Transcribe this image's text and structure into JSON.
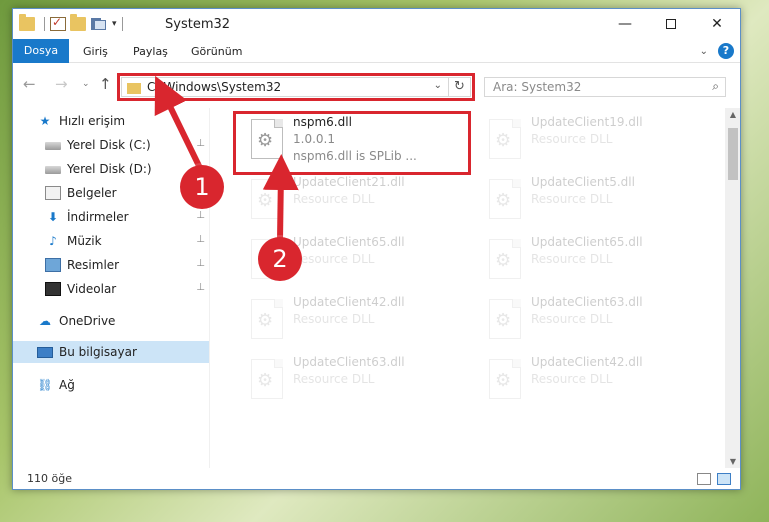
{
  "window": {
    "title": "System32",
    "min_glyph": "—",
    "close_glyph": "✕"
  },
  "ribbon": {
    "tabs": [
      "Dosya",
      "Giriş",
      "Paylaş",
      "Görünüm"
    ],
    "help_glyph": "?",
    "expand_glyph": "⌄"
  },
  "nav": {
    "back": "←",
    "forward": "→",
    "recent": "⌄",
    "up": "↑",
    "address": "C:\\Windows\\System32",
    "address_dropdown": "⌄",
    "refresh": "↻",
    "search_placeholder": "Ara: System32",
    "search_icon": "⌕"
  },
  "sidebar": {
    "items": [
      {
        "label": "Hızlı erişim",
        "icon": "star-icon",
        "glyph": "★",
        "pinned": false
      },
      {
        "label": "Yerel Disk (C:)",
        "icon": "disk-icon",
        "glyph": "",
        "pinned": true
      },
      {
        "label": "Yerel Disk (D:)",
        "icon": "disk-icon",
        "glyph": "",
        "pinned": false
      },
      {
        "label": "Belgeler",
        "icon": "documents-icon",
        "glyph": "",
        "pinned": false
      },
      {
        "label": "İndirmeler",
        "icon": "download-icon",
        "glyph": "⬇",
        "pinned": true
      },
      {
        "label": "Müzik",
        "icon": "music-icon",
        "glyph": "♪",
        "pinned": true
      },
      {
        "label": "Resimler",
        "icon": "pictures-icon",
        "glyph": "",
        "pinned": true
      },
      {
        "label": "Videolar",
        "icon": "video-icon",
        "glyph": "",
        "pinned": true
      },
      {
        "label": "OneDrive",
        "icon": "cloud-icon",
        "glyph": "☁",
        "pinned": false
      },
      {
        "label": "Bu bilgisayar",
        "icon": "computer-icon",
        "glyph": "",
        "pinned": false,
        "selected": true
      },
      {
        "label": "Ağ",
        "icon": "network-icon",
        "glyph": "⛓",
        "pinned": false
      }
    ],
    "pin_glyph": "📌"
  },
  "files": [
    {
      "name": "nspm6.dll",
      "line2": "1.0.0.1",
      "line3": "nspm6.dll is SPLib ...",
      "highlighted": true
    },
    {
      "name": "UpdateClient19.dll",
      "line2": "Resource DLL",
      "line3": "",
      "highlighted": false
    },
    {
      "name": "UpdateClient21.dll",
      "line2": "Resource DLL",
      "line3": "",
      "highlighted": false
    },
    {
      "name": "UpdateClient5.dll",
      "line2": "Resource DLL",
      "line3": "",
      "highlighted": false
    },
    {
      "name": "UpdateClient65.dll",
      "line2": "Resource DLL",
      "line3": "",
      "highlighted": false
    },
    {
      "name": "UpdateClient65.dll",
      "line2": "Resource DLL",
      "line3": "",
      "highlighted": false
    },
    {
      "name": "UpdateClient42.dll",
      "line2": "Resource DLL",
      "line3": "",
      "highlighted": false
    },
    {
      "name": "UpdateClient63.dll",
      "line2": "Resource DLL",
      "line3": "",
      "highlighted": false
    },
    {
      "name": "UpdateClient63.dll",
      "line2": "Resource DLL",
      "line3": "",
      "highlighted": false
    },
    {
      "name": "UpdateClient42.dll",
      "line2": "Resource DLL",
      "line3": "",
      "highlighted": false
    }
  ],
  "status": {
    "item_count": "110 öğe"
  },
  "annotations": {
    "step1": "1",
    "step2": "2",
    "color": "#d9262e"
  }
}
